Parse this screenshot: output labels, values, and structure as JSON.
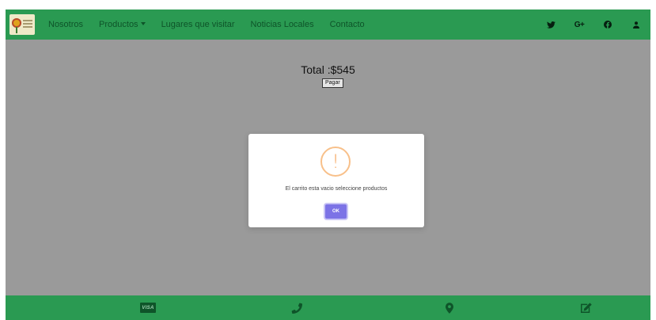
{
  "navbar": {
    "logo_alt": "Villa",
    "links": [
      {
        "label": "Nosotros"
      },
      {
        "label": "Productos",
        "has_dropdown": true
      },
      {
        "label": "Lugares que visitar"
      },
      {
        "label": "Noticias Locales"
      },
      {
        "label": "Contacto"
      }
    ],
    "icons": [
      "twitter-icon",
      "google-plus-icon",
      "facebook-icon",
      "user-icon"
    ],
    "google_plus_text": "G+"
  },
  "main": {
    "total_text": "Total :$545",
    "pay_button_label": "Pagar"
  },
  "modal": {
    "icon": "warning-icon",
    "icon_glyph": "!",
    "message": "El carrito esta vacio seleccione productos",
    "ok_label": "OK"
  },
  "footer": {
    "icons": [
      "visa-icon",
      "phone-icon",
      "map-marker-icon",
      "edit-icon"
    ],
    "visa_text": "VISA"
  },
  "colors": {
    "nav_green": "#2a9a52",
    "overlay_gray": "#9a9a9a",
    "ok_purple": "#7c73e6",
    "warning_orange": "#f8c08a"
  }
}
